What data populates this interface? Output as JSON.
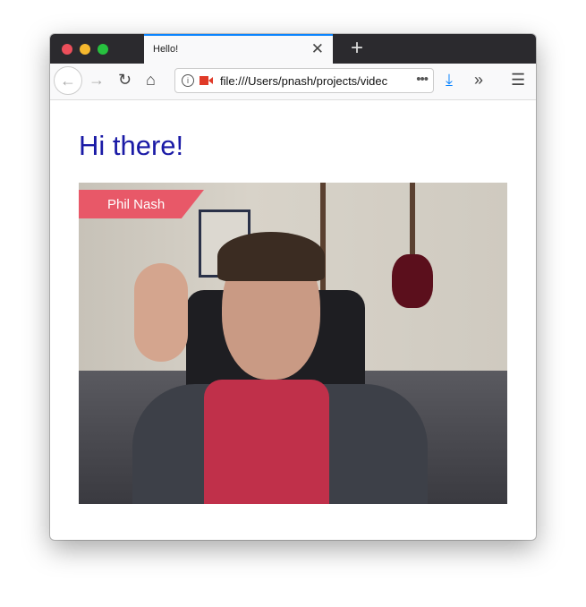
{
  "browser": {
    "tab_title": "Hello!",
    "url": "file:///Users/pnash/projects/video-chat/index.html",
    "url_visible": "file:///Users/pnash/projects/videc",
    "accent_color": "#0a84ff"
  },
  "page": {
    "heading": "Hi there!",
    "heading_color": "#1a1aa6",
    "participant_name": "Phil Nash",
    "badge_color": "#e85868"
  }
}
